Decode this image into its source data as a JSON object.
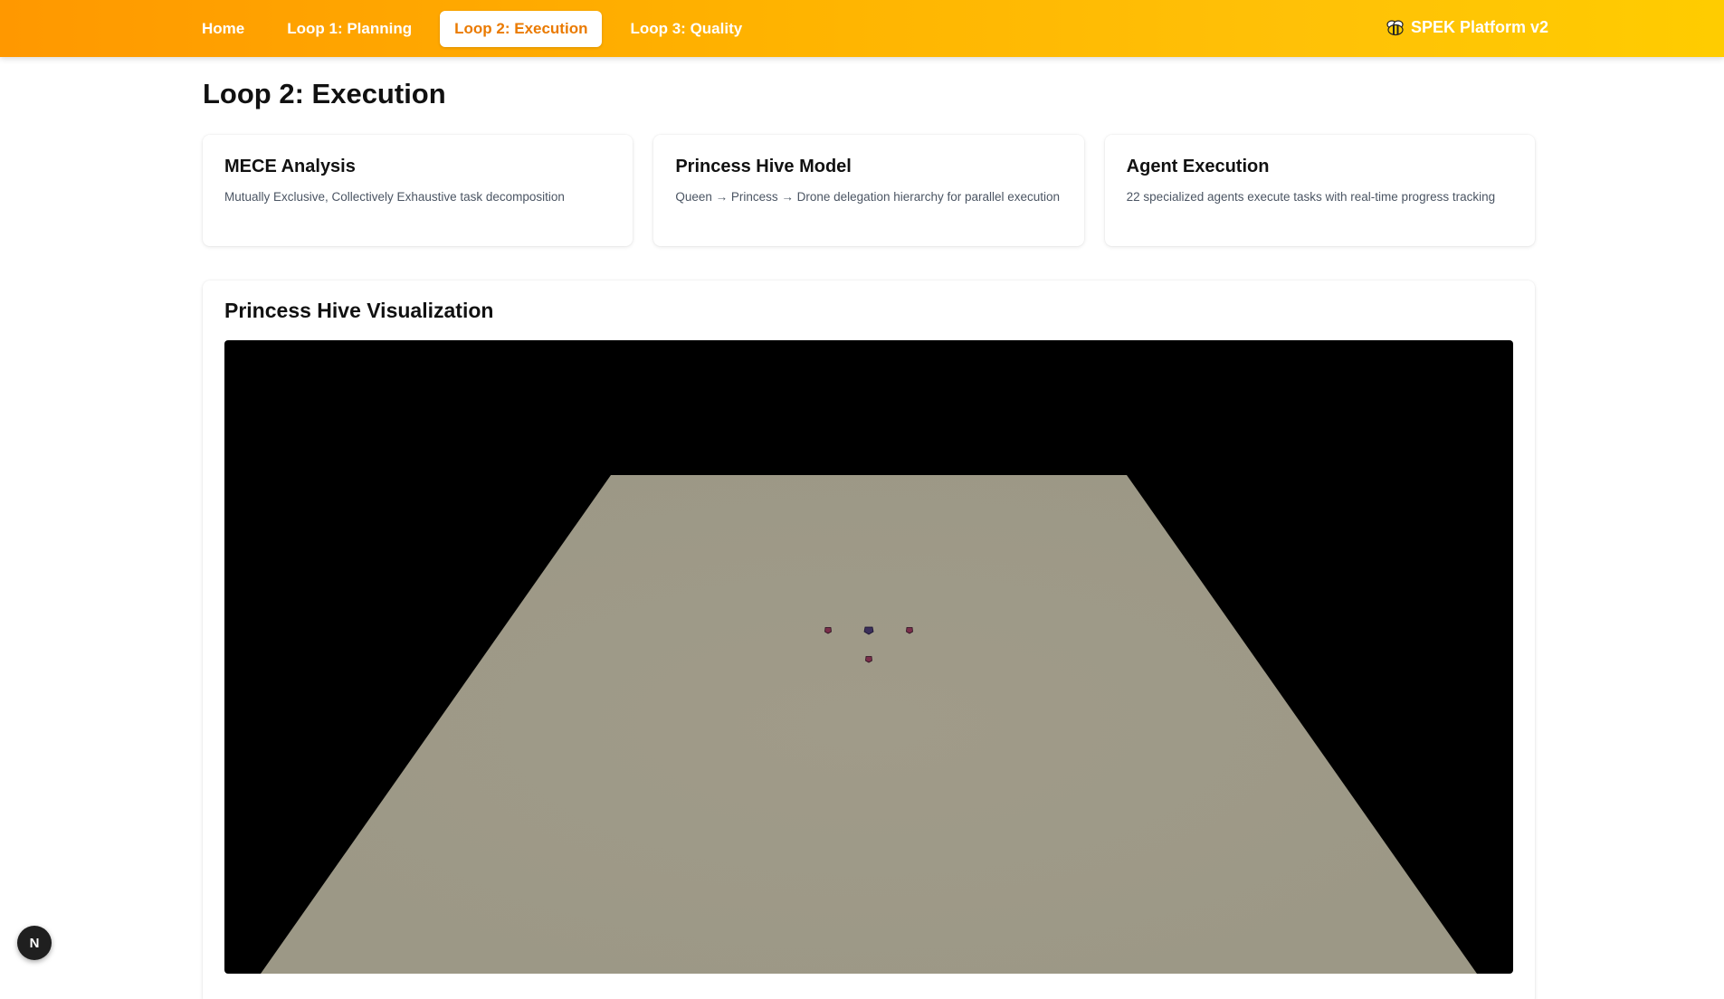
{
  "nav": {
    "items": [
      {
        "label": "Home",
        "active": false
      },
      {
        "label": "Loop 1: Planning",
        "active": false
      },
      {
        "label": "Loop 2: Execution",
        "active": true
      },
      {
        "label": "Loop 3: Quality",
        "active": false
      }
    ],
    "brand": {
      "icon": "bee-icon",
      "label": "SPEK Platform v2"
    }
  },
  "page": {
    "title": "Loop 2: Execution"
  },
  "cards": [
    {
      "title": "MECE Analysis",
      "description": "Mutually Exclusive, Collectively Exhaustive task decomposition"
    },
    {
      "title": "Princess Hive Model",
      "description": "Queen → Princess → Drone delegation hierarchy for parallel execution"
    },
    {
      "title": "Agent Execution",
      "description": "22 specialized agents execute tasks with real-time progress tracking"
    }
  ],
  "visualization": {
    "title": "Princess Hive Visualization",
    "scene": {
      "background": "#000000",
      "ground_color": "#9e9a88",
      "nodes": [
        {
          "role": "queen",
          "color": "#3b2f5a"
        },
        {
          "role": "princess",
          "color": "#7a2e4a"
        },
        {
          "role": "princess",
          "color": "#7a2e4a"
        },
        {
          "role": "princess",
          "color": "#7a2e4a"
        }
      ]
    }
  },
  "dev_badge": {
    "label": "N"
  },
  "colors": {
    "accent": "#ea7a00",
    "header_start": "#ff9800",
    "header_end": "#ffcc00"
  }
}
